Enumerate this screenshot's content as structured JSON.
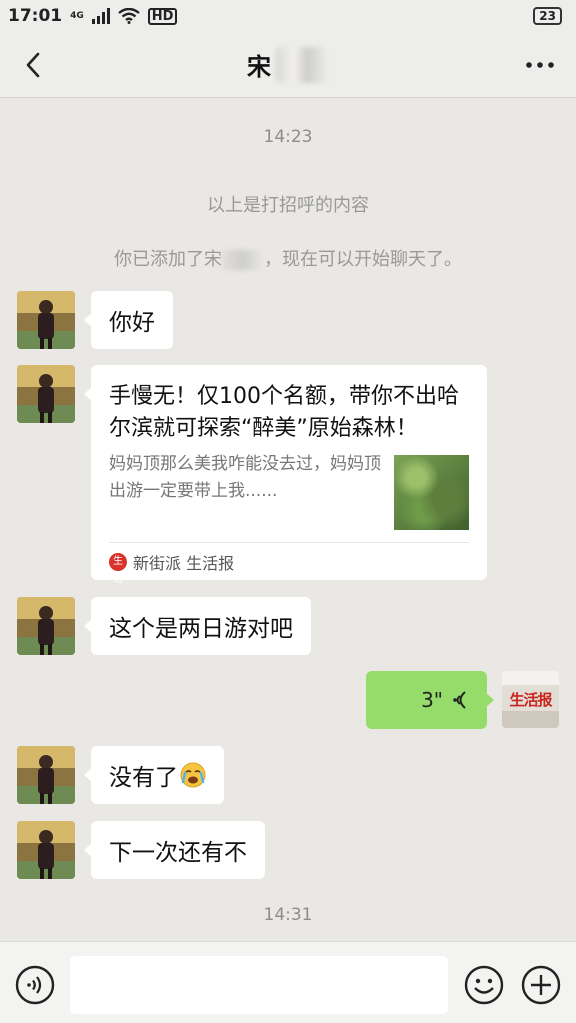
{
  "status_bar": {
    "time": "17:01",
    "net_top": "4G",
    "net_bottom": "ıl",
    "hd": "HD",
    "battery": "23"
  },
  "header": {
    "title": "宋",
    "back_icon": "chevron-left-icon",
    "more_icon": "more-horizontal-icon"
  },
  "chat": {
    "timestamps": [
      "14:23",
      "14:31"
    ],
    "system_greeting": "以上是打招呼的内容",
    "system_added_prefix": "你已添加了宋",
    "system_added_suffix": "，现在可以开始聊天了。",
    "messages": [
      {
        "text": "你好"
      },
      {
        "text": "这个是两日游对吧"
      },
      {
        "text": "没有了"
      },
      {
        "text": "下一次还有不"
      }
    ],
    "card": {
      "title": "手慢无！仅100个名额，带你不出哈尔滨就可探索“醉美”原始森林！",
      "desc": "妈妈顶那么美我咋能没去过，妈妈顶出游一定要带上我......",
      "source": "新街派 生活报",
      "source_icon_text": "生活"
    },
    "voice": {
      "duration": "3\""
    },
    "my_avatar_text": "生活报"
  },
  "input_bar": {
    "placeholder": "",
    "voice_icon": "voice-input-icon",
    "emoji_icon": "emoji-icon",
    "plus_icon": "plus-icon"
  },
  "colors": {
    "background": "#e9e8e5",
    "my_bubble": "#95dc6a",
    "other_bubble": "#ffffff"
  }
}
